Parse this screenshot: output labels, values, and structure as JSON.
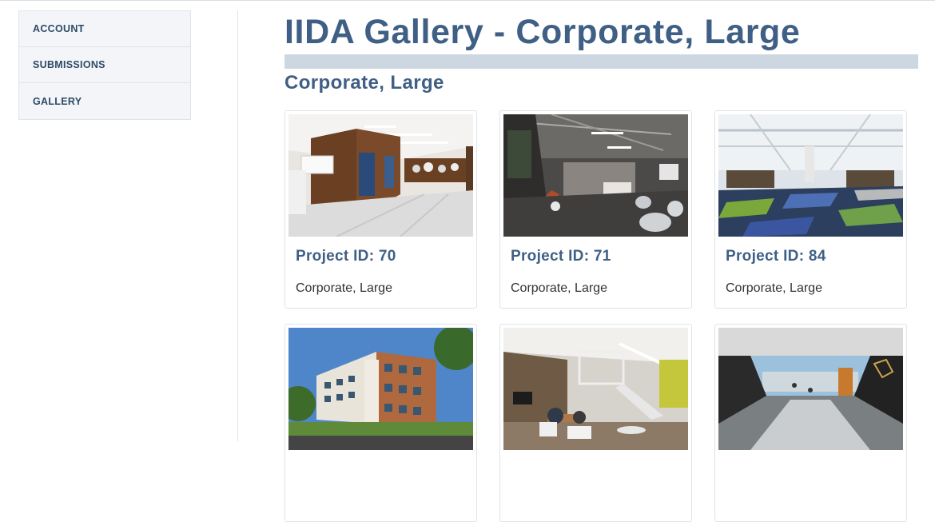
{
  "sidebar": {
    "items": [
      {
        "label": "ACCOUNT"
      },
      {
        "label": "SUBMISSIONS"
      },
      {
        "label": "GALLERY"
      }
    ]
  },
  "main": {
    "title": "IIDA Gallery - Corporate, Large",
    "section_title": "Corporate, Large",
    "projects": [
      {
        "id_label": "Project ID: 70",
        "category": "Corporate, Large",
        "photo": "lobby-wood-walls-photo"
      },
      {
        "id_label": "Project ID: 71",
        "category": "Corporate, Large",
        "photo": "atrium-lounge-photo"
      },
      {
        "id_label": "Project ID: 84",
        "category": "Corporate, Large",
        "photo": "open-office-carpet-photo"
      },
      {
        "id_label": "",
        "category": "",
        "photo": "brick-office-building-photo"
      },
      {
        "id_label": "",
        "category": "",
        "photo": "white-stair-lounge-photo"
      },
      {
        "id_label": "",
        "category": "",
        "photo": "dark-corridor-photo"
      }
    ]
  },
  "colors": {
    "accent": "#3f5f85",
    "title_bar": "#cdd7e2",
    "sidebar_bg": "#f3f5f8"
  }
}
